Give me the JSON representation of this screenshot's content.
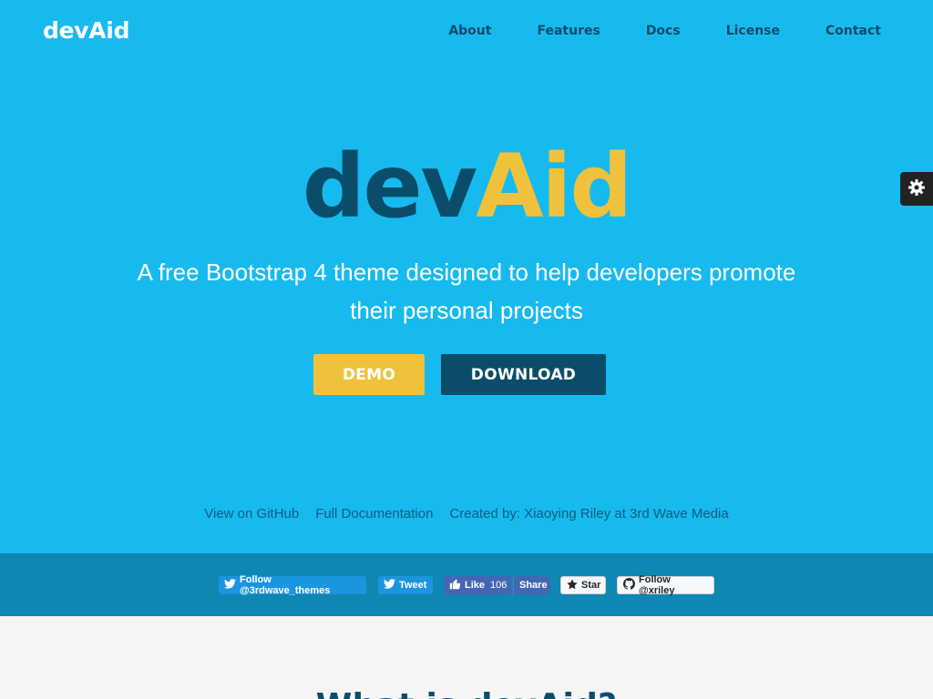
{
  "header": {
    "brand": "devAid",
    "nav": [
      "About",
      "Features",
      "Docs",
      "License",
      "Contact"
    ]
  },
  "hero": {
    "logo_dev": "dev",
    "logo_aid": "Aid",
    "tagline": "A free Bootstrap 4 theme designed to help developers promote their personal projects",
    "demo_label": "DEMO",
    "download_label": "DOWNLOAD",
    "links": [
      "View on GitHub",
      "Full Documentation",
      "Created by: Xiaoying Riley at 3rd Wave Media"
    ]
  },
  "social": {
    "twitter_follow": "Follow @3rdwave_themes",
    "tweet": "Tweet",
    "fb_like": "Like",
    "fb_count": "106",
    "fb_share": "Share",
    "github_star": "Star",
    "github_follow": "Follow @xriley"
  },
  "section2": {
    "title": "What is devAid?"
  },
  "colors": {
    "hero_bg": "#17baef",
    "dark_blue": "#0b4d69",
    "accent_yellow": "#f0c23c",
    "social_bar": "#1087b3"
  },
  "icons": {
    "settings": "gear-icon",
    "twitter": "twitter-bird-icon",
    "facebook": "facebook-thumb-icon",
    "github_star": "star-icon",
    "github_logo": "github-octocat-icon"
  }
}
